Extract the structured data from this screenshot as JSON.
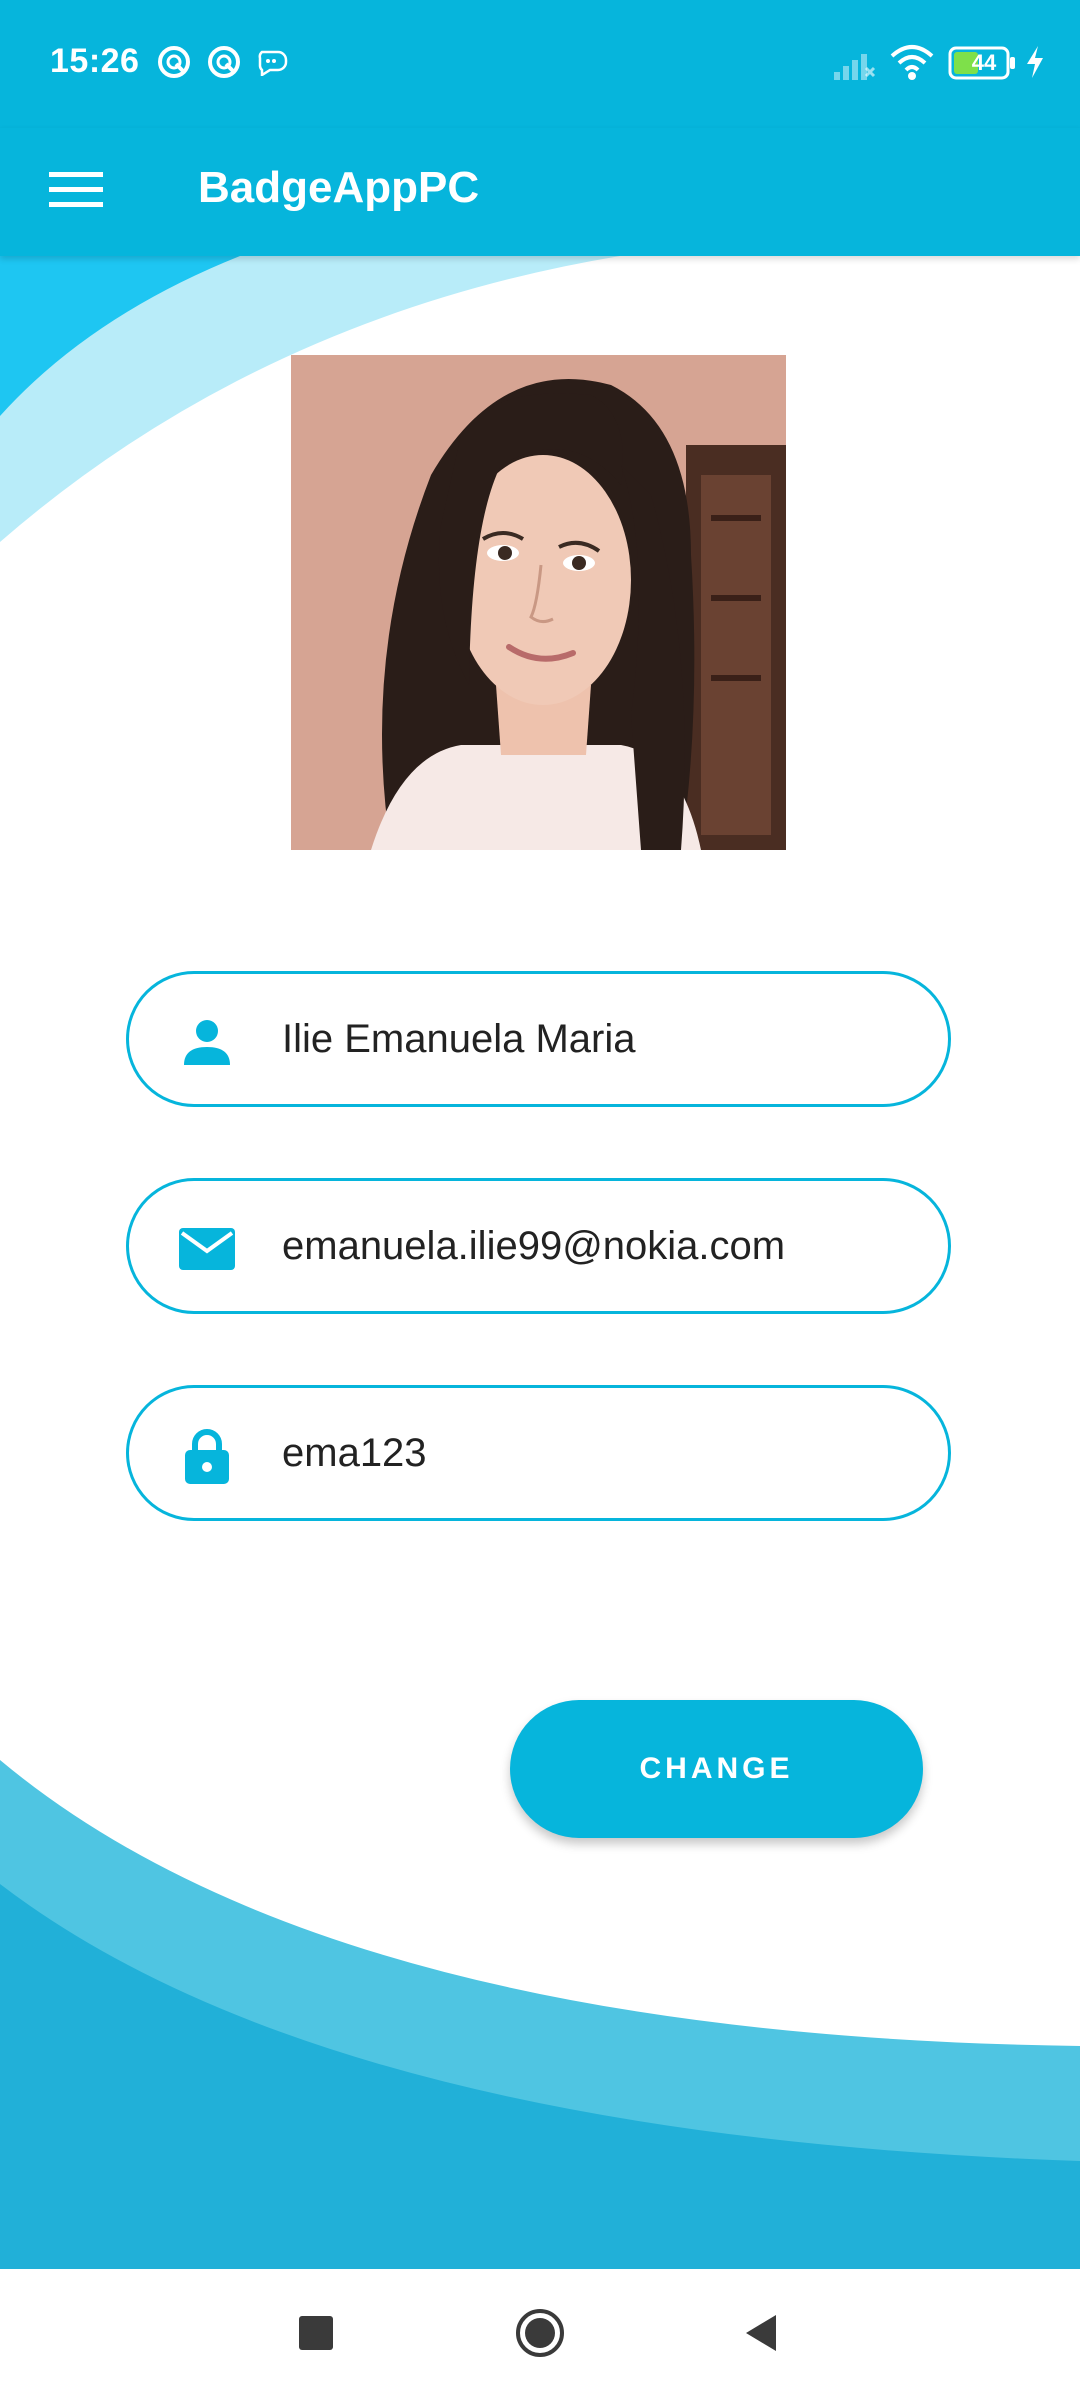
{
  "status_bar": {
    "time": "15:26",
    "battery_level": "44",
    "icons": [
      "sync-icon",
      "sync-icon",
      "spay-icon",
      "signal-icon",
      "wifi-icon",
      "battery-icon",
      "charging-icon"
    ]
  },
  "app_bar": {
    "title": "BadgeAppPC",
    "menu_icon": "hamburger-menu-icon"
  },
  "profile": {
    "photo": "profile-photo"
  },
  "fields": {
    "name": {
      "value": "Ilie Emanuela Maria",
      "icon": "person-icon"
    },
    "email": {
      "value": "emanuela.ilie99@nokia.com",
      "icon": "email-icon"
    },
    "password": {
      "value": "ema123",
      "icon": "lock-icon"
    }
  },
  "actions": {
    "change_label": "CHANGE"
  },
  "nav_bar": {
    "items": [
      "recents-square-icon",
      "home-circle-icon",
      "back-triangle-icon"
    ]
  },
  "colors": {
    "primary": "#06b5dc",
    "wave_light": "#b8ecf9",
    "wave_mid": "#4fc5e2",
    "wave_dark": "#21b0d8",
    "text": "#222222"
  }
}
